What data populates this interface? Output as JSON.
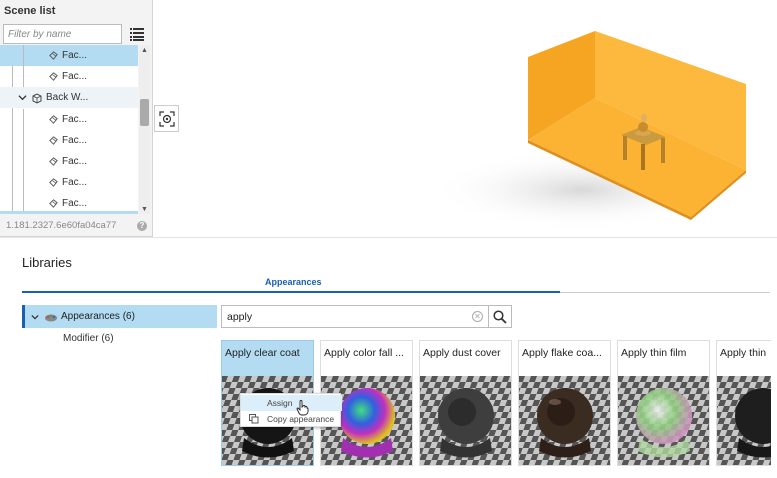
{
  "scene_list": {
    "title": "Scene list",
    "filter_placeholder": "Filter by name",
    "rows": [
      {
        "label": "Fac...",
        "type": "face"
      },
      {
        "label": "Fac...",
        "type": "face"
      },
      {
        "label": "Back W...",
        "type": "group"
      },
      {
        "label": "Fac...",
        "type": "face"
      },
      {
        "label": "Fac...",
        "type": "face"
      },
      {
        "label": "Fac...",
        "type": "face"
      },
      {
        "label": "Fac...",
        "type": "face"
      },
      {
        "label": "Fac...",
        "type": "face"
      }
    ],
    "version": "1.181.2327.6e60fa04ca77",
    "help_icon": "?"
  },
  "libraries": {
    "title": "Libraries",
    "tab": "Appearances",
    "category": "Appearances (6)",
    "subcategory": "Modifier (6)",
    "search_value": "apply",
    "cards": [
      {
        "label": "Apply clear coat",
        "color": "#141414"
      },
      {
        "label": "Apply color fall ...",
        "color": "#8a2be2"
      },
      {
        "label": "Apply dust cover",
        "color": "#3c3c3c"
      },
      {
        "label": "Apply flake coa...",
        "color": "#3a2a20"
      },
      {
        "label": "Apply thin film",
        "color": "#9ad08a"
      },
      {
        "label": "Apply thin",
        "color": "#1e1e1e"
      }
    ]
  },
  "context_menu": {
    "assign": "Assign",
    "copy": "Copy appearance"
  },
  "colors": {
    "accent": "#1a5fb4",
    "selection": "#b3dcf3",
    "room": "#fbb13c"
  }
}
